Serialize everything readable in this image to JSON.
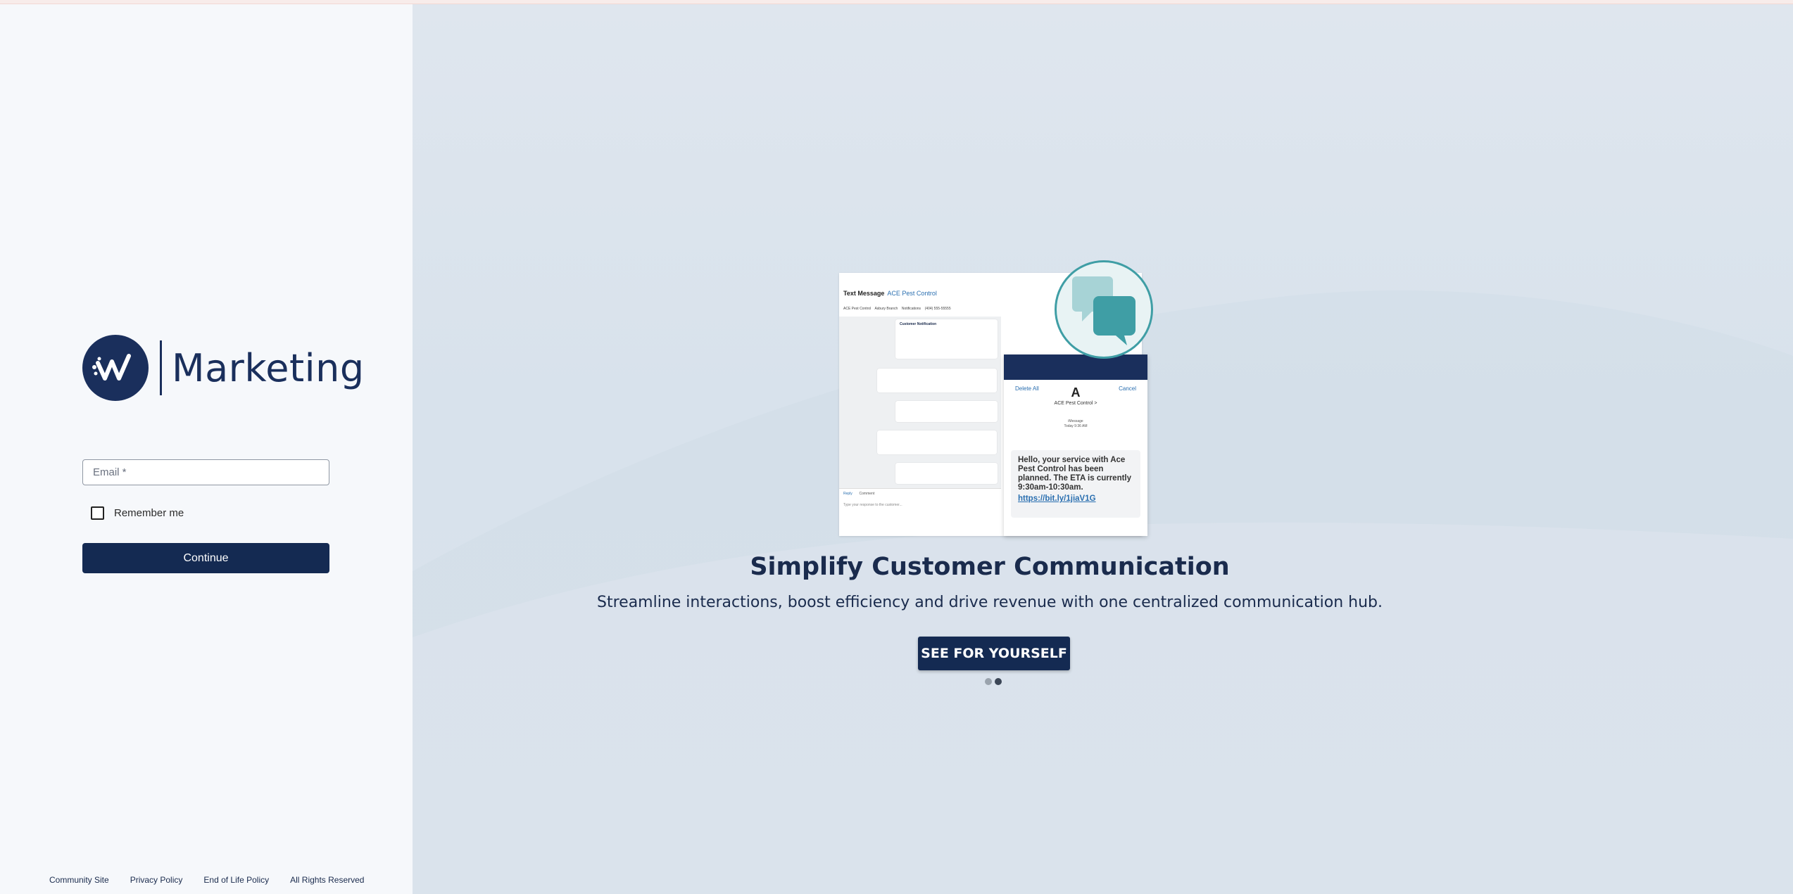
{
  "brand": {
    "name": "Marketing"
  },
  "login": {
    "email_placeholder": "Email *",
    "email_value": "",
    "remember_label": "Remember me",
    "remember_checked": false,
    "continue_label": "Continue"
  },
  "footer": {
    "links": [
      "Community Site",
      "Privacy Policy",
      "End of Life Policy",
      "All Rights Reserved"
    ]
  },
  "promo": {
    "headline": "Simplify Customer Communication",
    "subline": "Streamline interactions, boost efficiency and drive revenue with one centralized communication hub.",
    "cta_label": "SEE FOR YOURSELF",
    "carousel": {
      "slides": 2,
      "active_index": 1
    },
    "illustration": {
      "title": "Text Message",
      "title_link": "ACE Pest Control",
      "subtitle_items": [
        "ACE Pest Control",
        "Asbury Branch",
        "Notifications",
        "(404) 555-55555"
      ],
      "notification_title": "Customer Notification",
      "reply_tabs": [
        "Reply",
        "Comment"
      ],
      "reply_placeholder": "Type your response to the customer...",
      "phone_header_left": "Delete All",
      "phone_header_right": "Cancel",
      "phone_contact_initial": "A",
      "phone_contact_name": "ACE Pest Control >",
      "phone_meta": "iMessage",
      "phone_time": "Today 9:36 AM",
      "phone_message": "Hello, your service with Ace Pest Control has been planned. The ETA is currently 9:30am-10:30am.",
      "phone_link": "https://bit.ly/1jiaV1G"
    }
  },
  "colors": {
    "navy": "#142a52",
    "left_bg": "#f6f8fb",
    "right_bg": "#dfe6ee",
    "teal_accent": "#3f9ea5"
  }
}
